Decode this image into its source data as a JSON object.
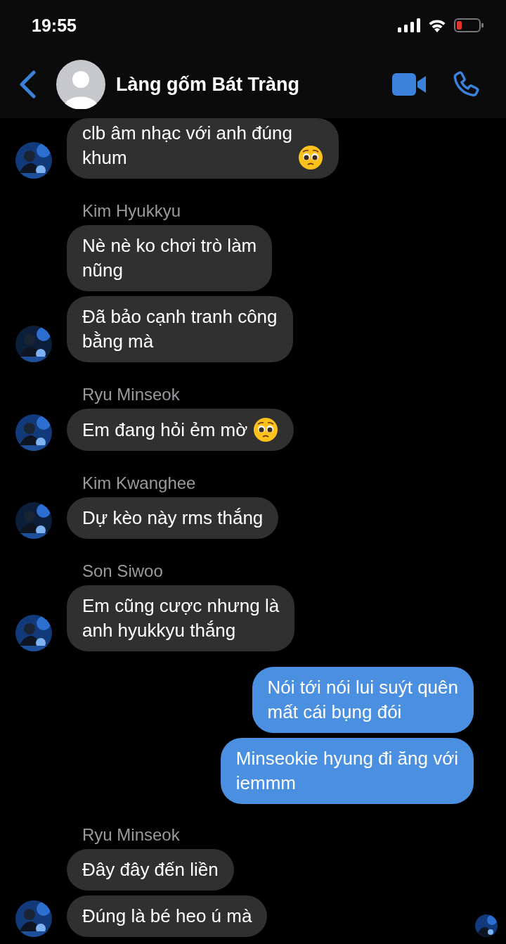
{
  "status_bar": {
    "time": "19:55"
  },
  "header": {
    "title": "Làng gốm Bát Tràng"
  },
  "groups": [
    {
      "kind": "incoming",
      "seen": false,
      "messages": [
        {
          "text": "clb âm nhạc với anh đúng\nkhum",
          "emoji": true
        }
      ]
    },
    {
      "kind": "incoming",
      "seen": false,
      "sender": "Kim Hyukkyu",
      "messages": [
        {
          "text": "Nè nè ko chơi trò làm\nnũng",
          "emoji": false
        },
        {
          "text": "Đã bảo cạnh tranh công\nbằng mà",
          "emoji": false
        }
      ]
    },
    {
      "kind": "incoming",
      "seen": false,
      "sender": "Ryu Minseok",
      "messages": [
        {
          "text": "Em đang hỏi ẻm mờ",
          "emoji": true
        }
      ]
    },
    {
      "kind": "incoming",
      "seen": false,
      "sender": "Kim Kwanghee",
      "messages": [
        {
          "text": "Dự kèo này rms thắng",
          "emoji": false
        }
      ]
    },
    {
      "kind": "incoming",
      "seen": false,
      "sender": "Son Siwoo",
      "messages": [
        {
          "text": "Em cũng cược nhưng là\nanh hyukkyu thắng",
          "emoji": false
        }
      ]
    },
    {
      "kind": "outgoing",
      "seen": false,
      "messages": [
        {
          "text": "Nói tới nói lui suýt quên\nmất cái bụng đói",
          "emoji": false
        },
        {
          "text": "Minseokie hyung đi ăng với\niemmm",
          "emoji": false
        }
      ]
    },
    {
      "kind": "incoming",
      "seen": true,
      "sender": "Ryu Minseok",
      "messages": [
        {
          "text": "Đây đây đến liền",
          "emoji": false
        },
        {
          "text": "Đúng là bé heo ú mà",
          "emoji": false
        }
      ]
    }
  ]
}
